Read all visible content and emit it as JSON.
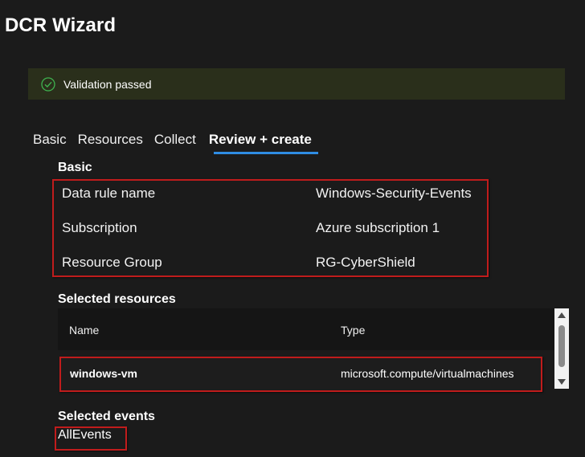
{
  "window": {
    "title": "DCR Wizard"
  },
  "banner": {
    "text": "Validation passed",
    "icon": "check-circle-icon",
    "icon_color": "#3fb34f",
    "background": "#2a2f1b"
  },
  "tabs": [
    {
      "label": "Basic",
      "active": false
    },
    {
      "label": "Resources",
      "active": false
    },
    {
      "label": "Collect",
      "active": false
    },
    {
      "label": "Review + create",
      "active": true
    }
  ],
  "accent_color": "#2f8de4",
  "highlight_color": "#c01c1c",
  "basic": {
    "title": "Basic",
    "rows": [
      {
        "label": "Data rule name",
        "value": "Windows-Security-Events"
      },
      {
        "label": "Subscription",
        "value": "Azure subscription 1"
      },
      {
        "label": "Resource Group",
        "value": "RG-CyberShield"
      }
    ]
  },
  "resources": {
    "title": "Selected resources",
    "columns": [
      "Name",
      "Type"
    ],
    "rows": [
      {
        "name": "windows-vm",
        "type": "microsoft.compute/virtualmachines"
      }
    ]
  },
  "events": {
    "title": "Selected events",
    "value": "AllEvents"
  }
}
